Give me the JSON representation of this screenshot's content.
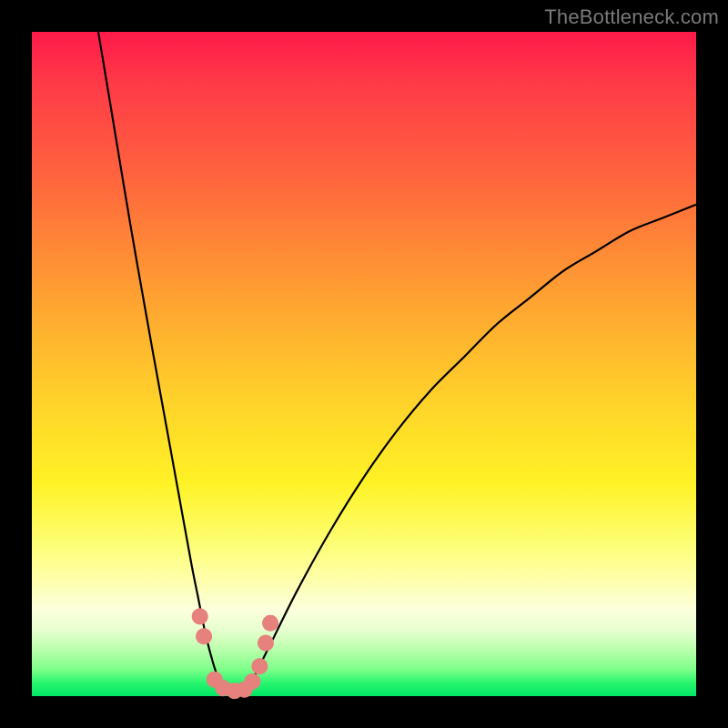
{
  "watermark": "TheBottleneck.com",
  "colors": {
    "frame": "#000000",
    "curve_stroke": "#000000",
    "marker_fill": "#e6817d",
    "gradient_top": "#ff1a4a",
    "gradient_bottom": "#00e765"
  },
  "chart_data": {
    "type": "line",
    "title": "",
    "xlabel": "",
    "ylabel": "",
    "xlim": [
      0,
      100
    ],
    "ylim": [
      0,
      100
    ],
    "note": "V-shaped bottleneck curve; y≈0 is optimum (green), y→100 is worst (red). Minimum ≈ x=30.",
    "series": [
      {
        "name": "bottleneck-curve",
        "x": [
          10,
          12,
          15,
          18,
          20,
          22,
          24,
          25,
          26,
          27,
          28,
          30,
          32,
          33,
          34,
          36,
          40,
          45,
          50,
          55,
          60,
          65,
          70,
          75,
          80,
          85,
          90,
          95,
          100
        ],
        "y": [
          100,
          88,
          70,
          53,
          42,
          31,
          20,
          15,
          10,
          6,
          3,
          0,
          1,
          2,
          4,
          8,
          16,
          25,
          33,
          40,
          46,
          51,
          56,
          60,
          64,
          67,
          70,
          72,
          74
        ]
      }
    ],
    "markers": [
      {
        "x": 25.3,
        "y": 12
      },
      {
        "x": 25.9,
        "y": 9
      },
      {
        "x": 27.5,
        "y": 2.5
      },
      {
        "x": 28.8,
        "y": 1.2
      },
      {
        "x": 30.5,
        "y": 0.8
      },
      {
        "x": 32.0,
        "y": 1.0
      },
      {
        "x": 33.2,
        "y": 2.2
      },
      {
        "x": 34.3,
        "y": 4.5
      },
      {
        "x": 35.2,
        "y": 8
      },
      {
        "x": 35.9,
        "y": 11
      }
    ]
  }
}
